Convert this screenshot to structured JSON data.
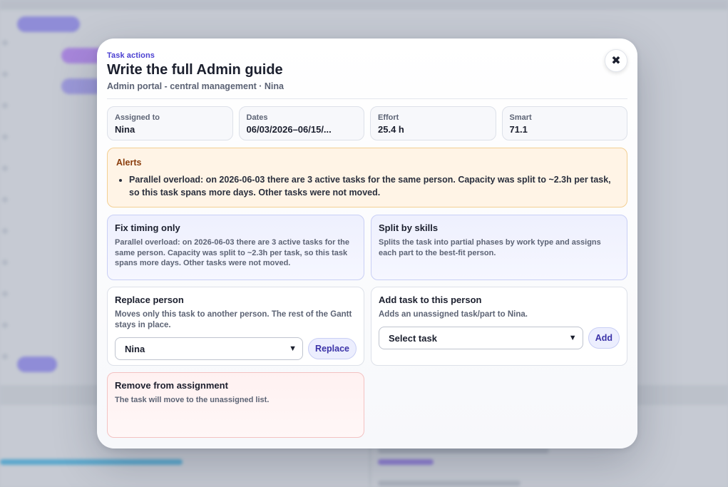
{
  "modal": {
    "eyebrow": "Task actions",
    "title": "Write the full Admin guide",
    "subtitle": "Admin portal - central management · Nina",
    "close_glyph": "✖"
  },
  "stats": [
    {
      "label": "Assigned to",
      "value": "Nina"
    },
    {
      "label": "Dates",
      "value": "06/03/2026–06/15/..."
    },
    {
      "label": "Effort",
      "value": "25.4 h"
    },
    {
      "label": "Smart",
      "value": "71.1"
    }
  ],
  "alerts": {
    "title": "Alerts",
    "items": [
      "Parallel overload: on 2026-06-03 there are 3 active tasks for the same person. Capacity was split to ~2.3h per task, so this task spans more days. Other tasks were not moved."
    ]
  },
  "actions": {
    "fix_timing": {
      "title": "Fix timing only",
      "desc": "Parallel overload: on 2026-06-03 there are 3 active tasks for the same person. Capacity was split to ~2.3h per task, so this task spans more days. Other tasks were not moved."
    },
    "split_skills": {
      "title": "Split by skills",
      "desc": "Splits the task into partial phases by work type and assigns each part to the best-fit person."
    },
    "replace_person": {
      "title": "Replace person",
      "desc": "Moves only this task to another person. The rest of the Gantt stays in place.",
      "select_value": "Nina",
      "button": "Replace"
    },
    "add_task": {
      "title": "Add task to this person",
      "desc": "Adds an unassigned task/part to Nina.",
      "select_value": "Select task",
      "button": "Add"
    },
    "remove": {
      "title": "Remove from assignment",
      "desc": "The task will move to the unassigned list."
    }
  },
  "colors": {
    "accent": "#4a3fd1",
    "alert_bg": "#fff4e6",
    "alert_title": "#8a3d0c",
    "danger_bg": "#fff1f1"
  }
}
